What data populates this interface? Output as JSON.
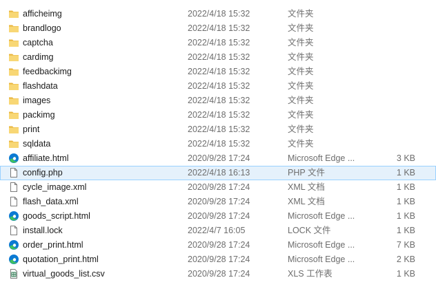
{
  "files": [
    {
      "name": "afficheimg",
      "date": "2022/4/18 15:32",
      "type": "文件夹",
      "size": "",
      "icon": "folder-icon"
    },
    {
      "name": "brandlogo",
      "date": "2022/4/18 15:32",
      "type": "文件夹",
      "size": "",
      "icon": "folder-icon"
    },
    {
      "name": "captcha",
      "date": "2022/4/18 15:32",
      "type": "文件夹",
      "size": "",
      "icon": "folder-icon"
    },
    {
      "name": "cardimg",
      "date": "2022/4/18 15:32",
      "type": "文件夹",
      "size": "",
      "icon": "folder-icon"
    },
    {
      "name": "feedbackimg",
      "date": "2022/4/18 15:32",
      "type": "文件夹",
      "size": "",
      "icon": "folder-icon"
    },
    {
      "name": "flashdata",
      "date": "2022/4/18 15:32",
      "type": "文件夹",
      "size": "",
      "icon": "folder-icon"
    },
    {
      "name": "images",
      "date": "2022/4/18 15:32",
      "type": "文件夹",
      "size": "",
      "icon": "folder-icon"
    },
    {
      "name": "packimg",
      "date": "2022/4/18 15:32",
      "type": "文件夹",
      "size": "",
      "icon": "folder-icon"
    },
    {
      "name": "print",
      "date": "2022/4/18 15:32",
      "type": "文件夹",
      "size": "",
      "icon": "folder-icon"
    },
    {
      "name": "sqldata",
      "date": "2022/4/18 15:32",
      "type": "文件夹",
      "size": "",
      "icon": "folder-icon"
    },
    {
      "name": "affiliate.html",
      "date": "2020/9/28 17:24",
      "type": "Microsoft Edge ...",
      "size": "3 KB",
      "icon": "edge-html-icon"
    },
    {
      "name": "config.php",
      "date": "2022/4/18 16:13",
      "type": "PHP 文件",
      "size": "1 KB",
      "icon": "file-icon",
      "selected": true
    },
    {
      "name": "cycle_image.xml",
      "date": "2020/9/28 17:24",
      "type": "XML 文档",
      "size": "1 KB",
      "icon": "file-icon"
    },
    {
      "name": "flash_data.xml",
      "date": "2020/9/28 17:24",
      "type": "XML 文档",
      "size": "1 KB",
      "icon": "file-icon"
    },
    {
      "name": "goods_script.html",
      "date": "2020/9/28 17:24",
      "type": "Microsoft Edge ...",
      "size": "1 KB",
      "icon": "edge-html-icon"
    },
    {
      "name": "install.lock",
      "date": "2022/4/7 16:05",
      "type": "LOCK 文件",
      "size": "1 KB",
      "icon": "file-icon"
    },
    {
      "name": "order_print.html",
      "date": "2020/9/28 17:24",
      "type": "Microsoft Edge ...",
      "size": "7 KB",
      "icon": "edge-html-icon"
    },
    {
      "name": "quotation_print.html",
      "date": "2020/9/28 17:24",
      "type": "Microsoft Edge ...",
      "size": "2 KB",
      "icon": "edge-html-icon"
    },
    {
      "name": "virtual_goods_list.csv",
      "date": "2020/9/28 17:24",
      "type": "XLS 工作表",
      "size": "1 KB",
      "icon": "spreadsheet-icon"
    }
  ],
  "colors": {
    "folder": "#f8d775",
    "folder_dark": "#e8b33a",
    "edge_blue": "#0c7ad4",
    "edge_green": "#3fc05e",
    "spreadsheet_green": "#1e7145",
    "selection_bg": "#e5f1fb",
    "selection_border": "#99d1ff"
  }
}
